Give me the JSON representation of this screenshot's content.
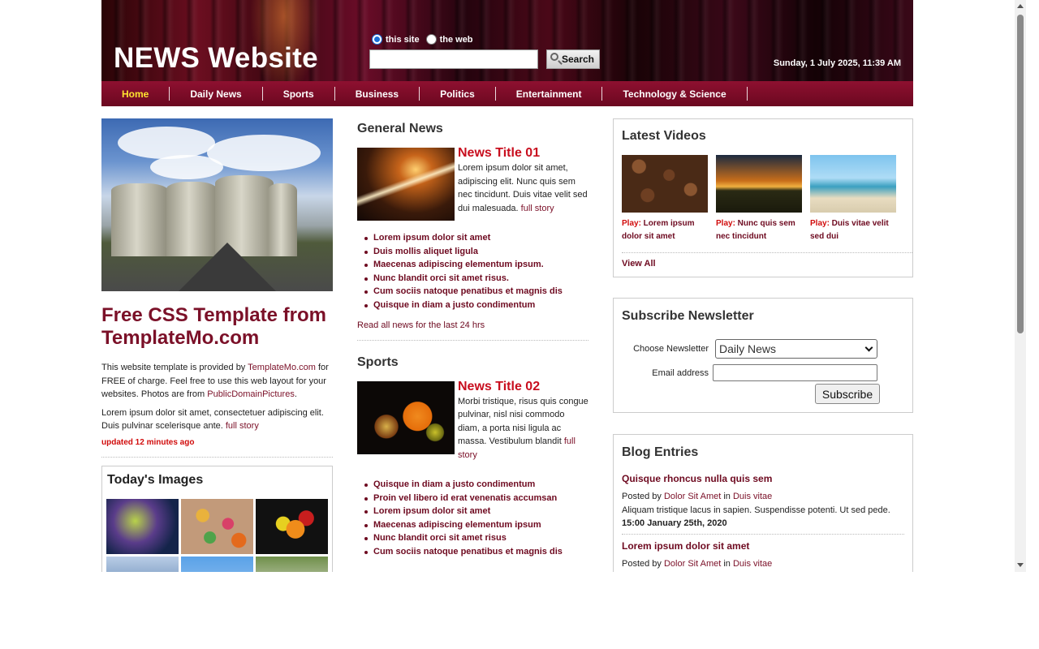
{
  "header": {
    "site_title": "NEWS Website",
    "search_option_site": "this site",
    "search_option_web": "the web",
    "search_value": "",
    "search_button": "Search",
    "datetime": "Sunday, 1 July 2025, 11:39 AM"
  },
  "menu": {
    "items": [
      {
        "label": "Home"
      },
      {
        "label": "Daily News"
      },
      {
        "label": "Sports"
      },
      {
        "label": "Business"
      },
      {
        "label": "Politics"
      },
      {
        "label": "Entertainment"
      },
      {
        "label": "Technology & Science"
      }
    ]
  },
  "left": {
    "feature_title": "Free CSS Template from TemplateMo.com",
    "intro_1": "This website template is provided by ",
    "intro_link_1": "TemplateMo.com",
    "intro_2": " for FREE of charge. Feel free to use this web layout for your websites. Photos are from ",
    "intro_link_2": "PublicDomainPictures",
    "intro_3": ".",
    "lorem": "Lorem ipsum dolor sit amet, consectetuer adipiscing elit. Duis pulvinar scelerisque ante. ",
    "full_story": "full story",
    "updated": "updated 12 minutes ago",
    "today_images_title": "Today's Images"
  },
  "middle": {
    "general_title": "General News",
    "news1_title": "News Title 01",
    "news1_text": "Lorem ipsum dolor sit amet, adipiscing elit. Nunc quis sem nec tincidunt. Duis vitae velit sed dui malesuada. ",
    "news1_link": "full story",
    "general_list": [
      "Lorem ipsum dolor sit amet",
      "Duis mollis aliquet ligula",
      "Maecenas adipiscing elementum ipsum.",
      "Nunc blandit orci sit amet risus.",
      "Cum sociis natoque penatibus et magnis dis",
      "Quisque in diam a justo condimentum"
    ],
    "read_all": "Read all news for the last 24 hrs",
    "sports_title": "Sports",
    "news2_title": "News Title 02",
    "news2_text": "Morbi tristique, risus quis congue pulvinar, nisl nisi commodo diam, a porta nisi ligula ac massa. Vestibulum blandit ",
    "news2_link": "full story",
    "sports_list": [
      "Quisque in diam a justo condimentum",
      "Proin vel libero id erat venenatis accumsan",
      "Lorem ipsum dolor sit amet",
      "Maecenas adipiscing elementum ipsum",
      "Nunc blandit orci sit amet risus",
      "Cum sociis natoque penatibus et magnis dis"
    ]
  },
  "right": {
    "videos_title": "Latest Videos",
    "play_label": "Play:",
    "videos": [
      {
        "caption": " Lorem ipsum dolor sit amet"
      },
      {
        "caption": " Nunc quis sem nec tincidunt"
      },
      {
        "caption": " Duis vitae velit sed dui"
      }
    ],
    "view_all": "View All",
    "newsletter_title": "Subscribe Newsletter",
    "choose_label": "Choose Newsletter",
    "choose_value": "Daily News",
    "email_label": "Email address",
    "email_value": "",
    "subscribe_button": "Subscribe",
    "blog_title": "Blog Entries",
    "entries": [
      {
        "title": "Quisque rhoncus nulla quis sem",
        "posted_by": "Posted by ",
        "author": "Dolor Sit Amet",
        "in": " in ",
        "category": "Duis vitae",
        "text": "Aliquam tristique lacus in sapien. Suspendisse potenti. Ut sed pede.",
        "date": "15:00 January 25th, 2020"
      },
      {
        "title": "Lorem ipsum dolor sit amet",
        "posted_by": "Posted by ",
        "author": "Dolor Sit Amet",
        "in": " in ",
        "category": "Duis vitae"
      }
    ]
  },
  "colors": {
    "accent": "#7b1028",
    "menu_bg": "#8e1030",
    "menu_active": "#ffe430",
    "news_title": "#c80e1e",
    "updated": "#d10c0c"
  },
  "icons": [
    "search-icon",
    "chevron-down-icon",
    "scroll-up-arrow-icon",
    "scroll-down-arrow-icon"
  ]
}
